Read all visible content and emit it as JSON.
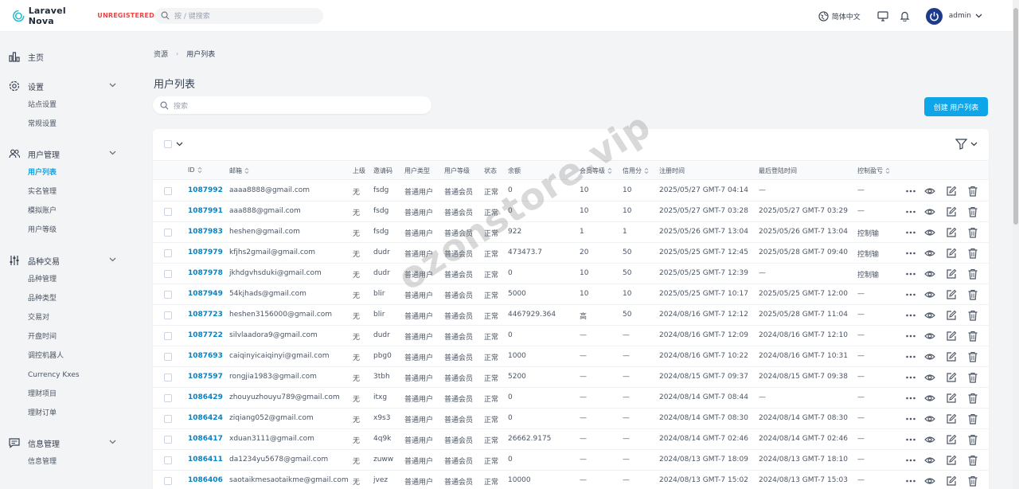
{
  "header": {
    "brand": "Laravel Nova",
    "badge": "UNREGISTERED",
    "search_placeholder": "按 / 键搜索",
    "language": "简体中文",
    "user": "admin"
  },
  "sidebar": {
    "groups": [
      {
        "label": "主页",
        "icon": "chart-icon",
        "items": []
      },
      {
        "label": "设置",
        "icon": "gear-icon",
        "items": [
          "站点设置",
          "常规设置"
        ]
      },
      {
        "label": "用户管理",
        "icon": "users-icon",
        "items": [
          "用户列表",
          "实名管理",
          "模拟账户",
          "用户等级"
        ]
      },
      {
        "label": "品种交易",
        "icon": "sliders-icon",
        "items": [
          "品种管理",
          "品种类型",
          "交易对",
          "开盘时间",
          "调控机器人",
          "Currency Kxes",
          "理财项目",
          "理财订单"
        ]
      },
      {
        "label": "信息管理",
        "icon": "message-icon",
        "items": [
          "信息管理"
        ]
      }
    ],
    "active_item": "用户列表"
  },
  "breadcrumb": {
    "root": "资源",
    "current": "用户列表"
  },
  "page": {
    "title": "用户列表",
    "search_placeholder": "搜索",
    "create_button": "创建 用户列表"
  },
  "table": {
    "columns": [
      "ID",
      "邮箱",
      "上级",
      "邀请码",
      "用户类型",
      "用户等级",
      "状态",
      "余额",
      "会员等级",
      "信用分",
      "注册时间",
      "最后登陆时间",
      "控制盈亏"
    ],
    "rows": [
      [
        "1087992",
        "aaaa8888@gmail.com",
        "无",
        "fsdg",
        "普通用户",
        "普通会员",
        "正常",
        "0",
        "10",
        "10",
        "2025/05/27 GMT-7 04:14",
        "—",
        "—"
      ],
      [
        "1087991",
        "aaa888@gmail.com",
        "无",
        "fsdg",
        "普通用户",
        "普通会员",
        "正常",
        "0",
        "10",
        "10",
        "2025/05/27 GMT-7 03:28",
        "2025/05/27 GMT-7 03:29",
        "—"
      ],
      [
        "1087983",
        "heshen@gmail.com",
        "无",
        "fsdg",
        "普通用户",
        "普通会员",
        "正常",
        "922",
        "1",
        "1",
        "2025/05/26 GMT-7 13:04",
        "2025/05/26 GMT-7 13:04",
        "控制输"
      ],
      [
        "1087979",
        "kfjhs2gmail@gmail.com",
        "无",
        "dudr",
        "普通用户",
        "普通会员",
        "正常",
        "473473.7",
        "20",
        "50",
        "2025/05/25 GMT-7 12:45",
        "2025/05/28 GMT-7 09:40",
        "控制输"
      ],
      [
        "1087978",
        "jkhdgvhsduki@gmail.com",
        "无",
        "dudr",
        "普通用户",
        "普通会员",
        "正常",
        "0",
        "10",
        "50",
        "2025/05/25 GMT-7 12:39",
        "—",
        "控制输"
      ],
      [
        "1087949",
        "54kjhads@gmail.com",
        "无",
        "blir",
        "普通用户",
        "普通会员",
        "正常",
        "5000",
        "10",
        "10",
        "2025/05/25 GMT-7 10:17",
        "2025/05/25 GMT-7 12:00",
        "—"
      ],
      [
        "1087723",
        "heshen3156000@gmail.com",
        "无",
        "blir",
        "普通用户",
        "普通会员",
        "正常",
        "4467929.364",
        "高",
        "50",
        "2024/08/16 GMT-7 12:12",
        "2025/05/28 GMT-7 11:04",
        "—"
      ],
      [
        "1087722",
        "silvlaadora9@gmail.com",
        "无",
        "dudr",
        "普通用户",
        "普通会员",
        "正常",
        "0",
        "—",
        "—",
        "2024/08/16 GMT-7 12:09",
        "2024/08/16 GMT-7 12:10",
        "—"
      ],
      [
        "1087693",
        "caiqinyicaiqinyi@gmail.com",
        "无",
        "pbg0",
        "普通用户",
        "普通会员",
        "正常",
        "1000",
        "—",
        "—",
        "2024/08/16 GMT-7 10:22",
        "2024/08/16 GMT-7 10:31",
        "—"
      ],
      [
        "1087597",
        "rongjia1983@gmail.com",
        "无",
        "3tbh",
        "普通用户",
        "普通会员",
        "正常",
        "5200",
        "—",
        "—",
        "2024/08/15 GMT-7 09:37",
        "2024/08/15 GMT-7 09:38",
        "—"
      ],
      [
        "1086429",
        "zhouyuzhouyu789@gmail.com",
        "无",
        "itxg",
        "普通用户",
        "普通会员",
        "正常",
        "0",
        "—",
        "—",
        "2024/08/14 GMT-7 08:44",
        "—",
        "—"
      ],
      [
        "1086424",
        "ziqiang052@gmail.com",
        "无",
        "x9s3",
        "普通用户",
        "普通会员",
        "正常",
        "0",
        "—",
        "—",
        "2024/08/14 GMT-7 08:30",
        "2024/08/14 GMT-7 08:30",
        "—"
      ],
      [
        "1086417",
        "xduan3111@gmail.com",
        "无",
        "4q9k",
        "普通用户",
        "普通会员",
        "正常",
        "26662.9175",
        "—",
        "—",
        "2024/08/14 GMT-7 02:46",
        "2024/08/14 GMT-7 02:46",
        "—"
      ],
      [
        "1086411",
        "da1234yu5678@gmail.com",
        "无",
        "zuww",
        "普通用户",
        "普通会员",
        "正常",
        "0",
        "—",
        "—",
        "2024/08/13 GMT-7 18:09",
        "2024/08/13 GMT-7 18:10",
        "—"
      ],
      [
        "1086406",
        "saotaikmesaotaikme@gmail.com",
        "无",
        "jvez",
        "普通用户",
        "普通会员",
        "正常",
        "10000",
        "—",
        "—",
        "2024/08/13 GMT-7 15:02",
        "2024/08/13 GMT-7 15:03",
        "—"
      ]
    ],
    "row_actions": [
      "more-icon",
      "eye-icon",
      "edit-icon",
      "trash-icon"
    ]
  },
  "watermark": "ozonstore.vip",
  "colors": {
    "accent": "#0ea5e9",
    "link": "#0284c7",
    "badge": "#ef4444"
  }
}
